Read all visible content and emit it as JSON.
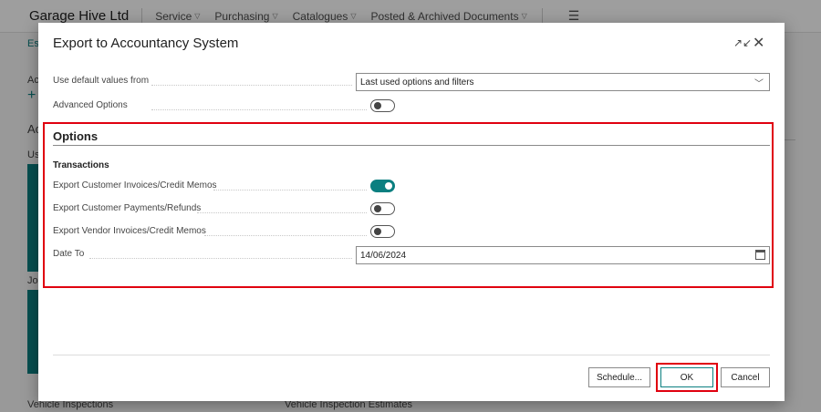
{
  "app": {
    "company": "Garage Hive Ltd",
    "nav": [
      "Service",
      "Purchasing",
      "Catalogues",
      "Posted & Archived Documents"
    ],
    "fragments": [
      "Est",
      "Act",
      "Ac",
      "Use",
      "Job",
      "Vehicle Inspections",
      "Vehicle Inspection Estimates"
    ]
  },
  "dialog": {
    "title": "Export to Accountancy System",
    "default_values_label": "Use default values from",
    "default_values_value": "Last used options and filters",
    "advanced_options_label": "Advanced Options",
    "advanced_options_on": false,
    "section_title": "Options",
    "group_title": "Transactions",
    "toggles": [
      {
        "label": "Export Customer Invoices/Credit Memos",
        "on": true
      },
      {
        "label": "Export Customer Payments/Refunds",
        "on": false
      },
      {
        "label": "Export Vendor Invoices/Credit Memos",
        "on": false
      }
    ],
    "date_to_label": "Date To",
    "date_to_value": "14/06/2024",
    "buttons": {
      "schedule": "Schedule...",
      "ok": "OK",
      "cancel": "Cancel"
    }
  },
  "colors": {
    "accent": "#0b7f80",
    "highlight": "#e0000f"
  }
}
